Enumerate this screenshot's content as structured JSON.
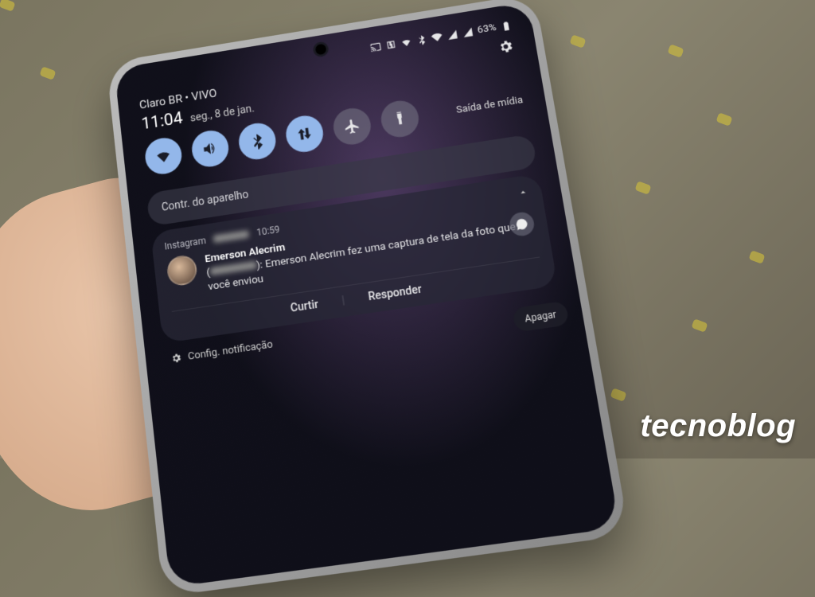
{
  "status": {
    "battery": "63%"
  },
  "carrier": "Claro BR • VIVO",
  "time": "11:04",
  "date": "seg., 8 de jan.",
  "quick": {
    "media_output": "Saída de mídia"
  },
  "device_controls": "Contr. do aparelho",
  "notification": {
    "app": "Instagram",
    "time": "10:59",
    "sender": "Emerson Alecrim",
    "body": "Emerson Alecrim fez uma captura de tela da foto que você enviou",
    "action_like": "Curtir",
    "action_reply": "Responder",
    "action_clear": "Apagar"
  },
  "footer": {
    "settings": "Config. notificação"
  },
  "watermark": "tecnoblog"
}
